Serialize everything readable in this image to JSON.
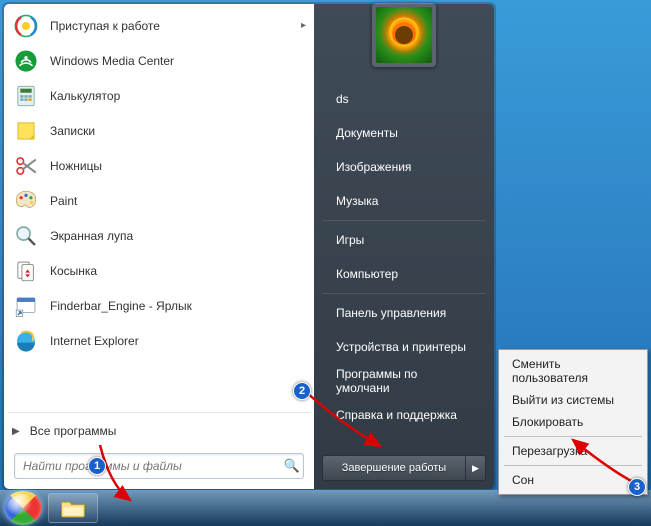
{
  "programs": [
    {
      "label": "Приступая к работе",
      "icon": "getting-started",
      "expand": true
    },
    {
      "label": "Windows Media Center",
      "icon": "wmc"
    },
    {
      "label": "Калькулятор",
      "icon": "calc"
    },
    {
      "label": "Записки",
      "icon": "notes"
    },
    {
      "label": "Ножницы",
      "icon": "snip"
    },
    {
      "label": "Paint",
      "icon": "paint"
    },
    {
      "label": "Экранная лупа",
      "icon": "magnifier"
    },
    {
      "label": "Косынка",
      "icon": "solitaire"
    },
    {
      "label": "Finderbar_Engine - Ярлык",
      "icon": "finderbar"
    },
    {
      "label": "Internet Explorer",
      "icon": "ie"
    }
  ],
  "all_programs_label": "Все программы",
  "search_placeholder": "Найти программы и файлы",
  "right_items_top": [
    "ds",
    "Документы",
    "Изображения",
    "Музыка"
  ],
  "right_items_mid": [
    "Игры",
    "Компьютер"
  ],
  "right_items_bot": [
    "Панель управления",
    "Устройства и принтеры",
    "Программы по умолчани",
    "Справка и поддержка"
  ],
  "shutdown_label": "Завершение работы",
  "submenu": {
    "group1": [
      "Сменить пользователя",
      "Выйти из системы",
      "Блокировать"
    ],
    "group2": [
      "Перезагрузка"
    ],
    "group3": [
      "Сон"
    ]
  },
  "markers": {
    "m1": "1",
    "m2": "2",
    "m3": "3"
  }
}
